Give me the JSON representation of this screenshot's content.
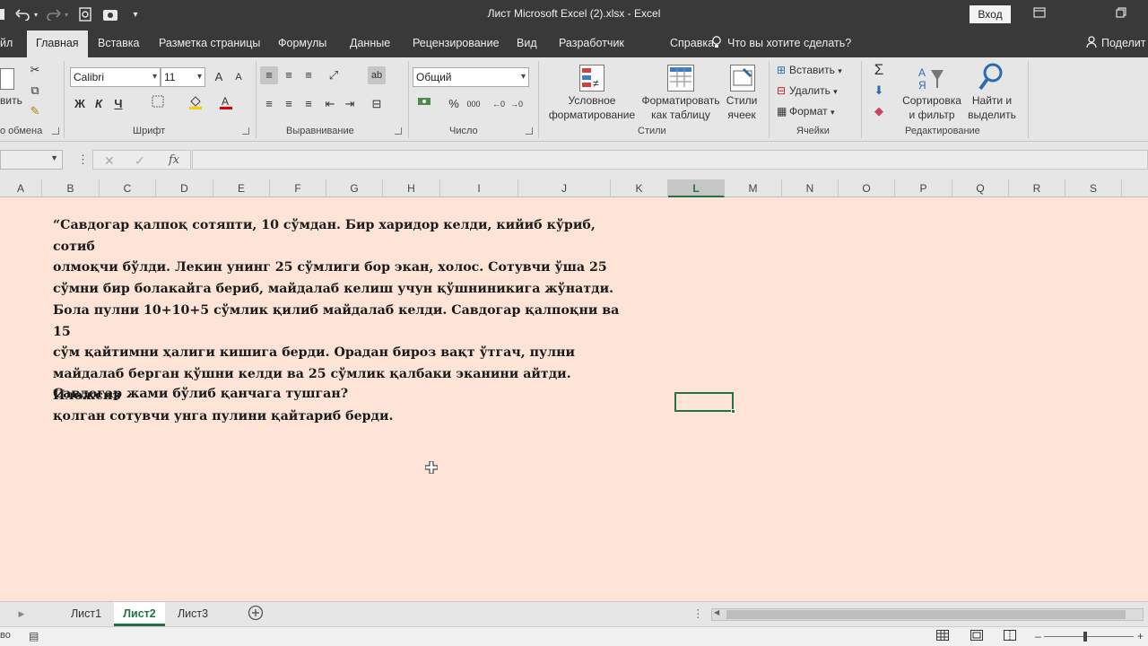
{
  "titlebar": {
    "title": "Лист Microsoft Excel (2).xlsx  -  Excel",
    "login": "Вход",
    "icons": [
      "save-icon",
      "undo-icon",
      "redo-icon",
      "preview-icon",
      "touch-mode-icon",
      "customize-qat-icon",
      "ribbon-display-icon",
      "restore-icon"
    ]
  },
  "tabs": {
    "file": "йл",
    "items": [
      "Главная",
      "Вставка",
      "Разметка страницы",
      "Формулы",
      "Данные",
      "Рецензирование",
      "Вид",
      "Разработчик",
      "Справка"
    ],
    "tell_me": "Что вы хотите сделать?",
    "share": "Поделит"
  },
  "ribbon": {
    "clipboard": {
      "paste_label": "вить",
      "group": "о обмена"
    },
    "font": {
      "name": "Calibri",
      "size": "11",
      "bold": "Ж",
      "italic": "К",
      "underline": "Ч",
      "group": "Шрифт",
      "grow": "A",
      "shrink": "A"
    },
    "alignment": {
      "group": "Выравнивание"
    },
    "number": {
      "format": "Общий",
      "group": "Число",
      "percent": "%",
      "thousands": "000"
    },
    "styles": {
      "conditional": [
        "Условное",
        "форматирование"
      ],
      "as_table": [
        "Форматировать",
        "как таблицу"
      ],
      "cell_styles": [
        "Стили",
        "ячеек"
      ],
      "group": "Стили"
    },
    "cells": {
      "insert": "Вставить",
      "delete": "Удалить",
      "format": "Формат",
      "group": "Ячейки"
    },
    "editing": {
      "sort": [
        "Сортировка",
        "и фильтр"
      ],
      "find": [
        "Найти и",
        "выделить"
      ],
      "group": "Редактирование"
    }
  },
  "formula_bar": {
    "cancel": "✕",
    "enter": "✓",
    "fx": "fx"
  },
  "columns": [
    "A",
    "B",
    "C",
    "D",
    "E",
    "F",
    "G",
    "H",
    "I",
    "J",
    "K",
    "L",
    "M",
    "N",
    "O",
    "P",
    "Q",
    "R",
    "S"
  ],
  "selected_column": "L",
  "content": {
    "problem_lines": [
      "“Савдогар қалпоқ сотяпти, 10 сўмдан. Бир харидор келди, кийиб кўриб, сотиб",
      "олмоқчи бўлди. Лекин унинг 25 сўмлиги бор экан, холос. Сотувчи ўша 25",
      "сўмни бир болакайга бериб, майдалаб келиш учун қўшниникига жўнатди.",
      "Бола пулни 10+10+5 сўмлик қилиб майдалаб келди. Савдогар қалпоқни ва 15",
      "сўм қайтимни ҳалиги кишига берди. Орадан бироз вақт ўтгач, пулни",
      "майдалаб берган қўшни келди ва 25 сўмлик қалбаки эканини айтди. Иложсиз",
      "қолган сотувчи унга пулини қайтариб берди."
    ],
    "question": "Савдогар жами бўлиб қанчага тушган?"
  },
  "sheets": {
    "items": [
      "Лист1",
      "Лист2",
      "Лист3"
    ],
    "active": "Лист2"
  },
  "statusbar": {
    "left": "во"
  }
}
